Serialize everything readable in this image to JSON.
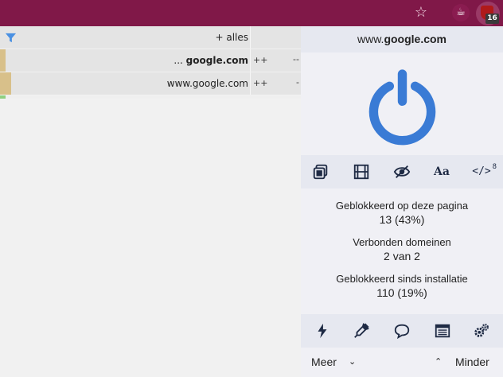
{
  "browser": {
    "bar_color": "#801848",
    "star_icon": "star-outline-icon",
    "extension_badge_count": "16"
  },
  "request_table": {
    "header": {
      "all_label": "+ alles"
    },
    "rows": [
      {
        "prefix": "... ",
        "domain": "google.com",
        "allow": "++",
        "block": "--"
      },
      {
        "prefix": "",
        "domain": "www.google.com",
        "allow": "++",
        "block": "-"
      }
    ]
  },
  "popup": {
    "hostname_prefix": "www.",
    "hostname_domain": "google.com",
    "power_color": "#3a7bd5",
    "tools_top": [
      {
        "name": "popup-blocker",
        "icon": "popup-window-icon"
      },
      {
        "name": "media",
        "icon": "film-icon"
      },
      {
        "name": "cosmetic",
        "icon": "eye-slash-icon"
      },
      {
        "name": "fonts",
        "icon": "fonts-icon",
        "label": "Aa"
      },
      {
        "name": "scripts",
        "icon": "code-icon",
        "label": "</>",
        "count": "8"
      }
    ],
    "stats": [
      {
        "label": "Geblokkeerd op deze pagina",
        "value": "13 (43%)"
      },
      {
        "label": "Verbonden domeinen",
        "value": "2 van 2"
      },
      {
        "label": "Geblokkeerd sinds installatie",
        "value": "110 (19%)"
      }
    ],
    "tools_bottom": [
      {
        "name": "zapper",
        "icon": "lightning-icon"
      },
      {
        "name": "picker",
        "icon": "eyedropper-icon"
      },
      {
        "name": "report",
        "icon": "speech-bubble-icon"
      },
      {
        "name": "logger",
        "icon": "list-icon"
      },
      {
        "name": "dashboard",
        "icon": "gears-icon"
      }
    ],
    "more_label": "Meer",
    "less_label": "Minder"
  }
}
